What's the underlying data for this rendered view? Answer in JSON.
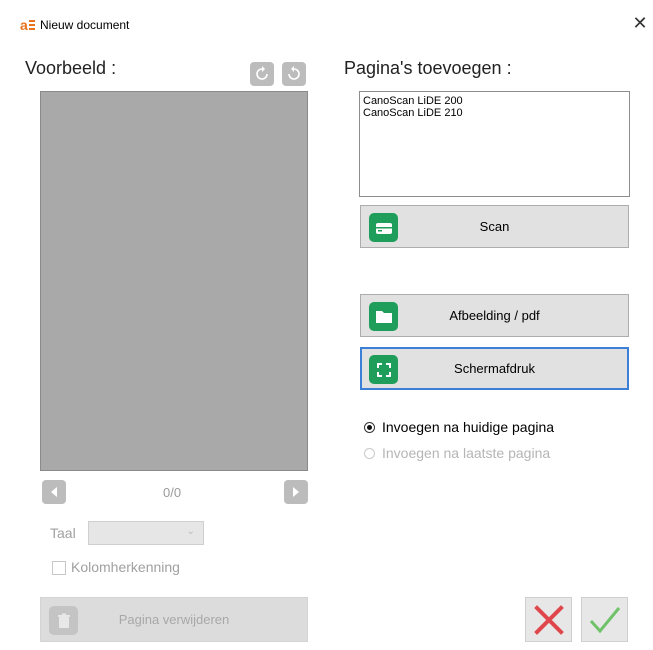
{
  "window": {
    "title": "Nieuw document",
    "close_glyph": "✕"
  },
  "preview": {
    "heading": "Voorbeeld :",
    "page_counter": "0/0"
  },
  "language": {
    "label": "Taal",
    "selected": ""
  },
  "column_detection": {
    "label": "Kolomherkenning",
    "checked": false
  },
  "delete_page": {
    "label": "Pagina verwijderen"
  },
  "add_pages": {
    "heading": "Pagina's toevoegen :",
    "scanners": [
      "CanoScan LiDE 200",
      "CanoScan LiDE 210"
    ],
    "scan_label": "Scan",
    "image_pdf_label": "Afbeelding / pdf",
    "screenshot_label": "Schermafdruk"
  },
  "insert_options": {
    "after_current": "Invoegen na huidige pagina",
    "after_last": "Invoegen na laatste pagina",
    "selected": "after_current"
  },
  "colors": {
    "accent_green": "#1e9e5a",
    "cancel_red": "#e0474c",
    "ok_green": "#6fc26a",
    "focus_blue": "#3c7fd6"
  }
}
